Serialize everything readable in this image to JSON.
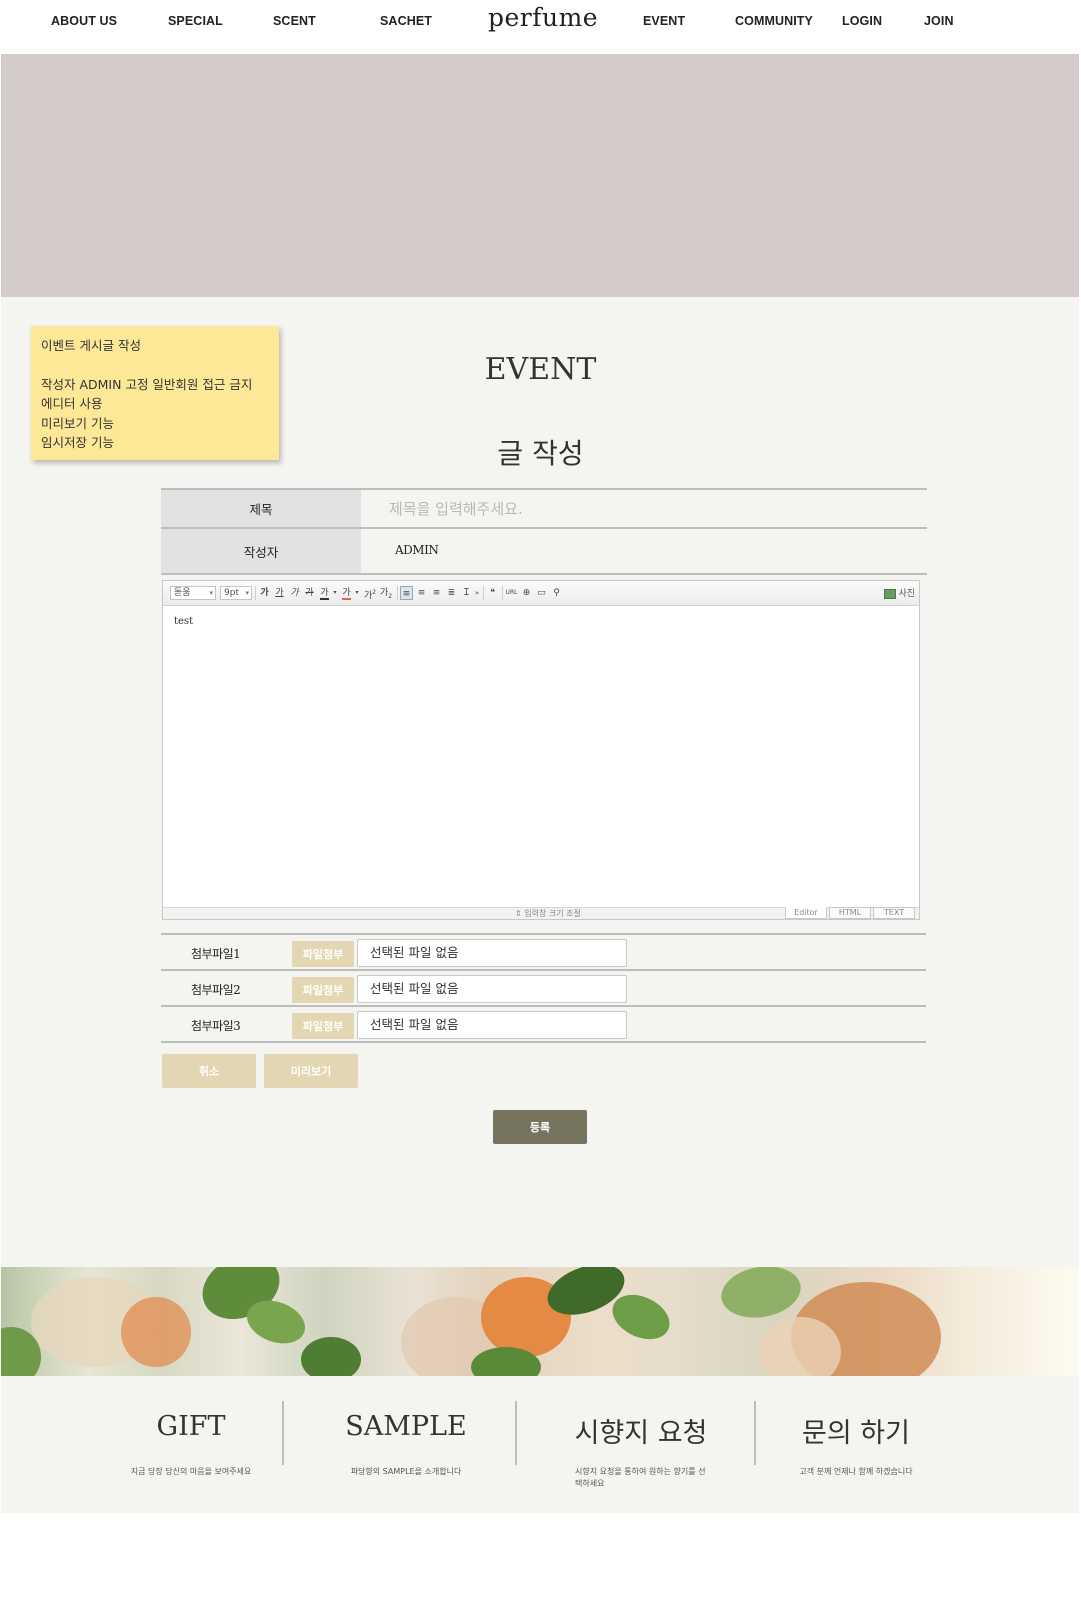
{
  "nav": {
    "about": "ABOUT US",
    "special": "SPECIAL",
    "scent": "SCENT",
    "sachet": "SACHET",
    "logo": "perfume",
    "event": "EVENT",
    "community": "COMMUNITY",
    "login": "LOGIN",
    "join": "JOIN"
  },
  "note": {
    "line1": "이벤트 게시글 작성",
    "line2": "작성자 ADMIN 고정  일반회원 접근 금지",
    "line3": "에디터 사용",
    "line4": "미리보기 기능",
    "line5": "임시저장 기능"
  },
  "page": {
    "heading": "EVENT",
    "subheading": "글 작성"
  },
  "form": {
    "title_label": "제목",
    "title_placeholder": "제목을 입력해주세요.",
    "writer_label": "작성자",
    "writer_value": "ADMIN"
  },
  "editor": {
    "font_select": "돋움",
    "size_select": "9pt",
    "bold": "가",
    "underline": "가",
    "italic": "가",
    "strike": "가",
    "sup": "가",
    "sub": "가",
    "photo_label": "사진",
    "content": "test",
    "resize_label": "⇕ 입력창 크기 조절",
    "tab_editor": "Editor",
    "tab_html": "HTML",
    "tab_text": "TEXT"
  },
  "attachments": [
    {
      "label": "첨부파일1",
      "button": "파일첨부",
      "file": "선택된 파일 없음"
    },
    {
      "label": "첨부파일2",
      "button": "파일첨부",
      "file": "선택된 파일 없음"
    },
    {
      "label": "첨부파일3",
      "button": "파일첨부",
      "file": "선택된 파일 없음"
    }
  ],
  "buttons": {
    "cancel": "취소",
    "preview": "미리보기",
    "submit": "등록"
  },
  "footer": [
    {
      "title": "GIFT",
      "desc": "지금 당장 당신의 마음을 보여주세요"
    },
    {
      "title": "SAMPLE",
      "desc": "파당향의 SAMPLE을 소개합니다"
    },
    {
      "title": "시향지 요청",
      "desc": "시향지 요청을 통하여 원하는 향기를 선택하세요"
    },
    {
      "title": "문의 하기",
      "desc": "고객 분께 언제나 함께 하겠습니다"
    }
  ],
  "colors": {
    "banner": "#d6cbcb",
    "note": "#fde898",
    "beige_button": "#e2d7b2",
    "submit_button": "#76735f",
    "background": "#f4f4f0"
  }
}
